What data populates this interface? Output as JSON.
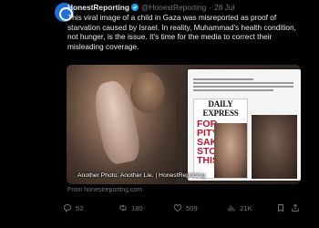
{
  "tweet": {
    "author_name": "HonestReporting",
    "author_handle": "@HonestReporting",
    "date": "28 Jul",
    "text": "This viral image of a child in Gaza was misreported as proof of starvation caused by Israel. In reality, Muhammad's health condition, not hunger, is the issue. It's time for the media to correct their misleading coverage.",
    "media_caption": "Another Photo. Another Lie. | HonestReporting",
    "embedded_paper_title": "DAILY EXPRESS",
    "embedded_headline": "FOR PITY'S SAKE STOP THIS",
    "source": "From honestreporting.com",
    "stats": {
      "replies": "52",
      "retweets": "180",
      "likes": "509",
      "views": "21K"
    }
  },
  "colors": {
    "background": "#000000",
    "text": "#e7e9ea",
    "muted": "#71767b",
    "verified": "#1d9bf0",
    "express_red": "#c8102e"
  },
  "icons": [
    "verified-badge-icon",
    "reply-icon",
    "retweet-icon",
    "like-icon",
    "views-icon",
    "bookmark-icon",
    "share-icon"
  ]
}
